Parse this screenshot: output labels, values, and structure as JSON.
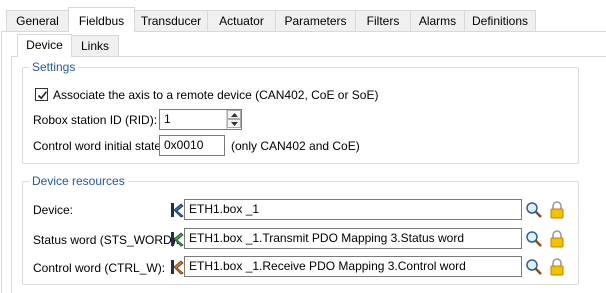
{
  "tabs": [
    {
      "label": "General",
      "active": false
    },
    {
      "label": "Fieldbus",
      "active": true
    },
    {
      "label": "Transducer",
      "active": false
    },
    {
      "label": "Actuator",
      "active": false
    },
    {
      "label": "Parameters",
      "active": false
    },
    {
      "label": "Filters",
      "active": false
    },
    {
      "label": "Alarms",
      "active": false
    },
    {
      "label": "Definitions",
      "active": false
    }
  ],
  "subtabs": [
    {
      "label": "Device",
      "active": true
    },
    {
      "label": "Links",
      "active": false
    }
  ],
  "settings": {
    "title": "Settings",
    "associate_checked": true,
    "associate_label": "Associate the axis to a remote device (CAN402, CoE or SoE)",
    "rid_label": "Robox station ID (RID):",
    "rid_value": "1",
    "cw_label": "Control word initial state:",
    "cw_value": "0x0010",
    "cw_note": "(only CAN402 and CoE)"
  },
  "resources": {
    "title": "Device resources",
    "rows": [
      {
        "label": "Device:",
        "value": "ETH1.box _1",
        "icon": "device-resource-icon"
      },
      {
        "label": "Status word (STS_WORD):",
        "value": "ETH1.box _1.Transmit PDO Mapping 3.Status word",
        "icon": "input-resource-icon"
      },
      {
        "label": "Control word (CTRL_W):",
        "value": "ETH1.box _1.Receive PDO Mapping 3.Control word",
        "icon": "output-resource-icon"
      }
    ]
  },
  "colors": {
    "group_title": "#1e5aa8",
    "tab_border": "#d9d9d9",
    "lock": "#e8b000"
  }
}
